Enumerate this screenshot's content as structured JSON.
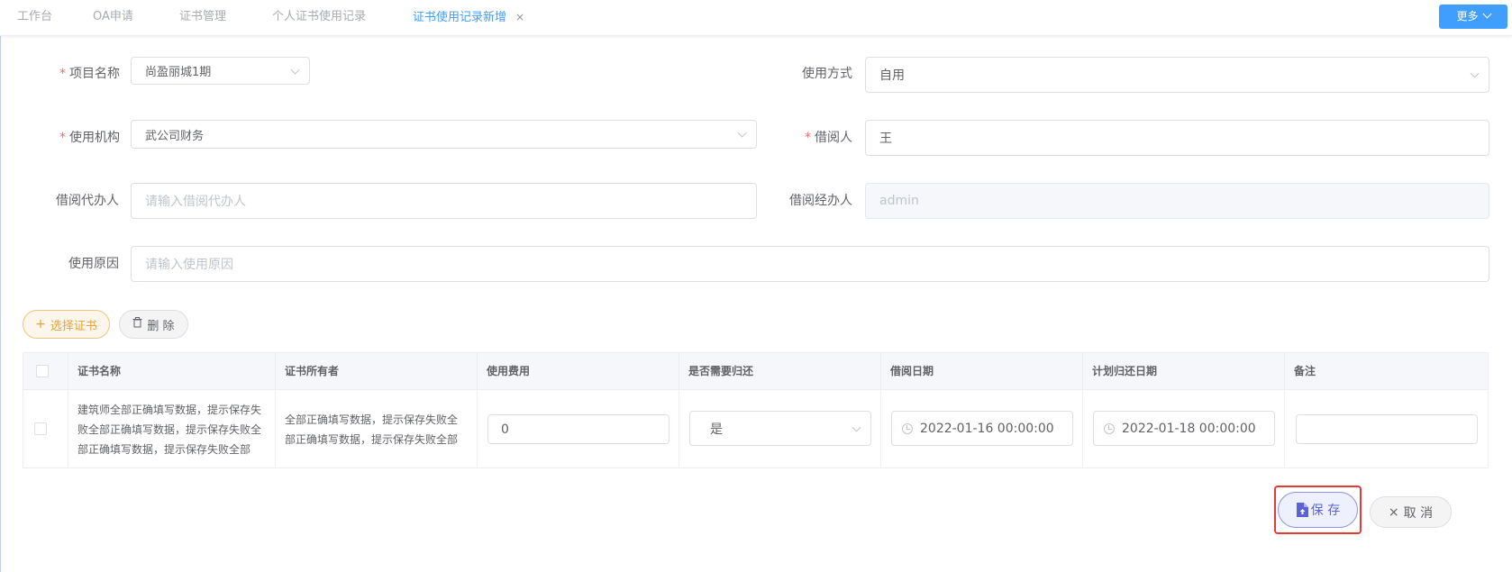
{
  "tabs": [
    {
      "label": "工作台"
    },
    {
      "label": "OA申请"
    },
    {
      "label": "证书管理"
    },
    {
      "label": "个人证书使用记录"
    },
    {
      "label": "证书使用记录新增",
      "close": "×"
    }
  ],
  "more_button": "更多",
  "form": {
    "required_mark": "*",
    "project_name": {
      "label": "项目名称",
      "value": "尚盈丽城1期"
    },
    "usage_method": {
      "label": "使用方式",
      "value": "自用"
    },
    "usage_org": {
      "label": "使用机构",
      "value": "武公司财务"
    },
    "borrower": {
      "label": "借阅人",
      "value": "王"
    },
    "borrow_agent": {
      "label": "借阅代办人",
      "placeholder": "请输入借阅代办人"
    },
    "borrow_handler": {
      "label": "借阅经办人",
      "value": "admin"
    },
    "usage_reason": {
      "label": "使用原因",
      "placeholder": "请输入使用原因"
    }
  },
  "actions": {
    "select_icon": "+",
    "select_label": "选择证书",
    "delete_label": "删 除"
  },
  "table": {
    "headers": [
      "证书名称",
      "证书所有者",
      "使用费用",
      "是否需要归还",
      "借阅日期",
      "计划归还日期",
      "备注"
    ],
    "rows": [
      {
        "cert_name": "建筑师全部正确填写数据，提示保存失败全部正确填写数据，提示保存失败全部正确填写数据，提示保存失败全部",
        "cert_owner": "全部正确填写数据，提示保存失败全部正确填写数据，提示保存失败全部",
        "fee": "0",
        "need_return": "是",
        "borrow_date": "2022-01-16 00:00:00",
        "return_date": "2022-01-18 00:00:00",
        "remark": ""
      }
    ]
  },
  "footer": {
    "save_label": "保 存",
    "cancel_icon": "×",
    "cancel_label": "取 消"
  },
  "colors": {
    "primary": "#409eff",
    "warning": "#e6a23c",
    "danger_outline": "#e53935",
    "save_accent": "#5b63d6"
  }
}
